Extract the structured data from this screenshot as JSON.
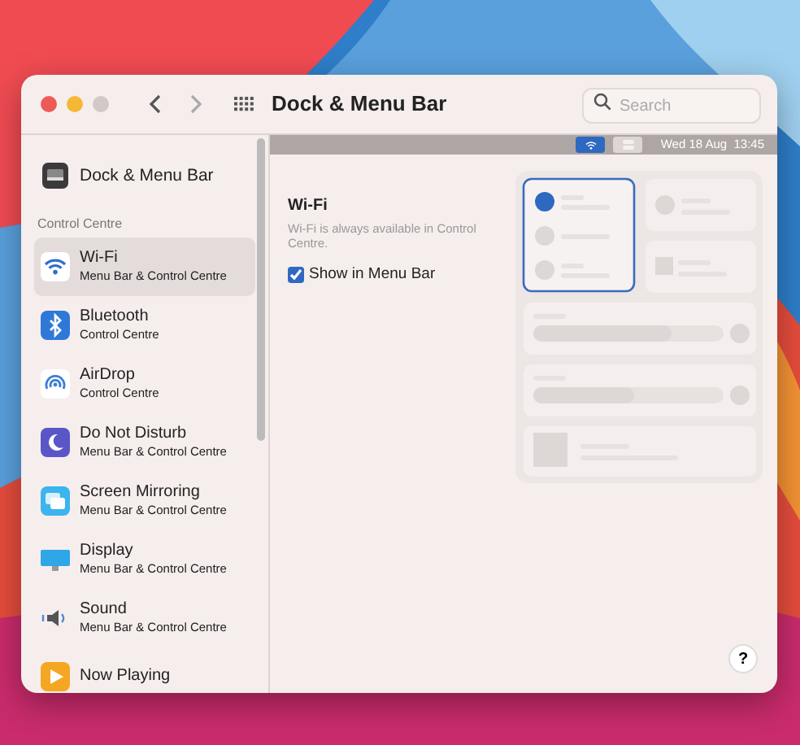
{
  "window": {
    "title": "Dock & Menu Bar",
    "search": {
      "placeholder": "Search"
    }
  },
  "sidebar": {
    "top_item": {
      "kind": "dock",
      "label": "Dock & Menu Bar"
    },
    "section": "Control Centre",
    "items": [
      {
        "kind": "wifi",
        "label": "Wi-Fi",
        "sublabel": "Menu Bar & Control Centre",
        "selected": true
      },
      {
        "kind": "bluetooth",
        "label": "Bluetooth",
        "sublabel": "Control Centre",
        "selected": false
      },
      {
        "kind": "airdrop",
        "label": "AirDrop",
        "sublabel": "Control Centre",
        "selected": false
      },
      {
        "kind": "moon",
        "label": "Do Not Disturb",
        "sublabel": "Menu Bar & Control Centre",
        "selected": false
      },
      {
        "kind": "mirroring",
        "label": "Screen Mirroring",
        "sublabel": "Menu Bar & Control Centre",
        "selected": false
      },
      {
        "kind": "display",
        "label": "Display",
        "sublabel": "Menu Bar & Control Centre",
        "selected": false
      },
      {
        "kind": "sound",
        "label": "Sound",
        "sublabel": "Menu Bar & Control Centre",
        "selected": false
      },
      {
        "kind": "play",
        "label": "Now Playing",
        "selected": false
      }
    ]
  },
  "menu_bar_preview": {
    "items": [
      {
        "kind": "wifi",
        "selected": true
      },
      {
        "kind": "controls",
        "selected": false
      }
    ],
    "clock": "Wed 18 Aug  13:45"
  },
  "detail": {
    "title": "Wi-Fi",
    "description": "Wi-Fi is always available in Control Centre.",
    "checkbox": {
      "label": "Show in Menu Bar",
      "checked": true
    }
  },
  "help": "?"
}
